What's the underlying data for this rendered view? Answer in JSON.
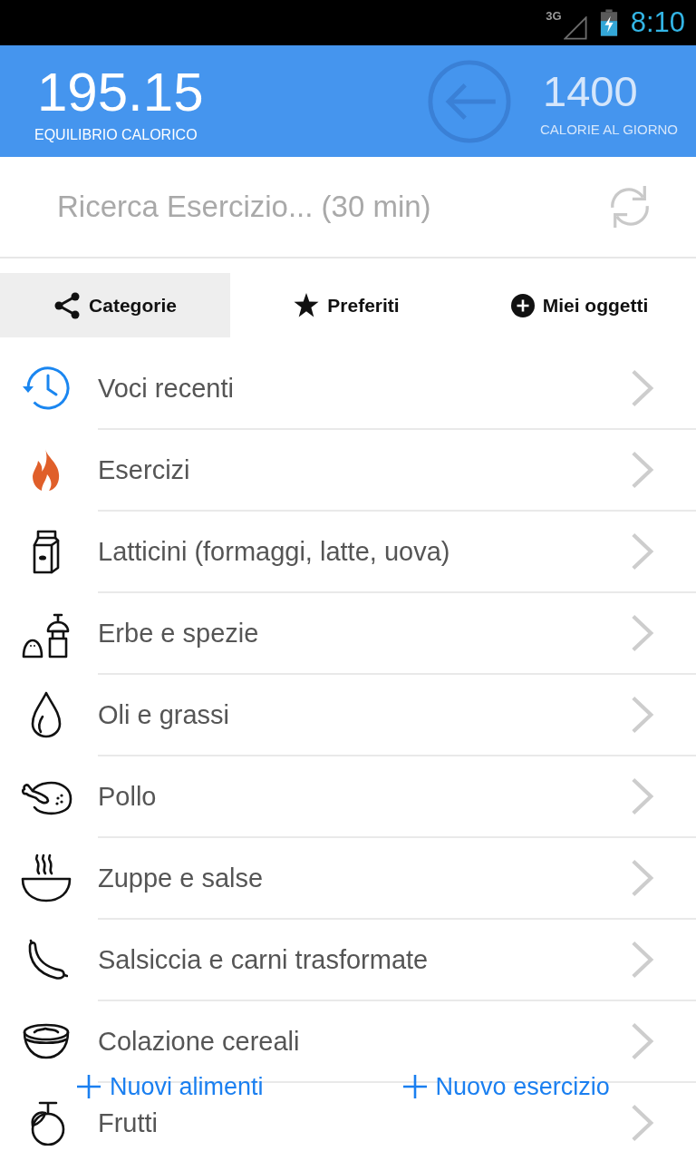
{
  "status_bar": {
    "network": "3G",
    "time": "8:10"
  },
  "header": {
    "balance": "195.15",
    "balance_label": "EQUILIBRIO CALORICO",
    "daily_goal": "1400",
    "daily_goal_label": "CALORIE AL GIORNO"
  },
  "search": {
    "placeholder": "Ricerca Esercizio... (30 min)"
  },
  "tabs": [
    {
      "label": "Categorie",
      "selected": true
    },
    {
      "label": "Preferiti",
      "selected": false
    },
    {
      "label": "Miei oggetti",
      "selected": false
    }
  ],
  "categories": [
    {
      "label": "Voci recenti"
    },
    {
      "label": "Esercizi"
    },
    {
      "label": "Latticini (formaggi, latte, uova)"
    },
    {
      "label": "Erbe e spezie"
    },
    {
      "label": "Oli e grassi"
    },
    {
      "label": "Pollo"
    },
    {
      "label": "Zuppe e salse"
    },
    {
      "label": "Salsiccia e carni trasformate"
    },
    {
      "label": "Colazione cereali"
    },
    {
      "label": "Frutti"
    }
  ],
  "actions": [
    {
      "label": "Nuovi alimenti"
    },
    {
      "label": "Nuovo esercizio"
    }
  ]
}
